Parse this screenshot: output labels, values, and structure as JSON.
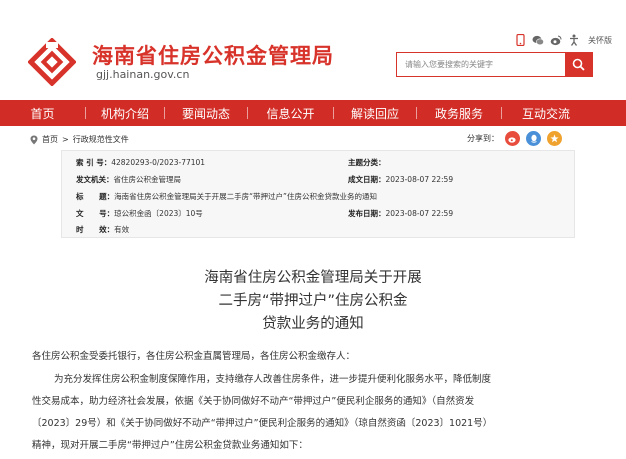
{
  "header": {
    "site_name": "海南省住房公积金管理局",
    "site_domain": "gjj.hainan.gov.cn",
    "elderly_mode": "关怀版",
    "search_placeholder": "请输入您要搜索的关键字",
    "brand_color": "#d8332a"
  },
  "nav": {
    "items": [
      "首页",
      "机构介绍",
      "要闻动态",
      "信息公开",
      "解读回应",
      "政务服务",
      "互动交流"
    ]
  },
  "breadcrumb": {
    "home": "首页",
    "sep": ">",
    "current": "行政规范性文件"
  },
  "share": {
    "label": "分享到："
  },
  "info": {
    "index_label": "索 引 号：",
    "index_value": "42820293-0/2023-77101",
    "subject_label": "主题分类：",
    "subject_value": "",
    "publisher_label": "发文机关：",
    "publisher_value": "省住房公积金管理局",
    "created_label": "成文日期：",
    "created_value": "2023-08-07 22:59",
    "title_label": "标      题：",
    "title_value": "海南省住房公积金管理局关于开展二手房“带押过户”住房公积金贷款业务的通知",
    "docno_label": "文      号：",
    "docno_value": "琼公积金函〔2023〕10号",
    "published_label": "发布日期：",
    "published_value": "2023-08-07 22:59",
    "validity_label": "时      效：",
    "validity_value": "有效"
  },
  "article": {
    "title_line1": "海南省住房公积金管理局关于开展",
    "title_line2": "二手房“带押过户”住房公积金",
    "title_line3": "贷款业务的通知",
    "p1": "各住房公积金受委托银行，各住房公积金直属管理局，各住房公积金缴存人：",
    "p2_line1": "为充分发挥住房公积金制度保障作用，支持缴存人改善住房条件，进一步提升便利化服务水平，降低制度",
    "p2_line2": "性交易成本，助力经济社会发展，依据《关于协同做好不动产“带押过户”便民利企服务的通知》（自然资发",
    "p2_line3": "〔2023〕29号）和《关于协同做好不动产“带押过户”便民利企服务的通知》（琼自然资函〔2023〕1021号）",
    "p2_line4": "精神，现对开展二手房“带押过户”住房公积金贷款业务通知如下："
  }
}
